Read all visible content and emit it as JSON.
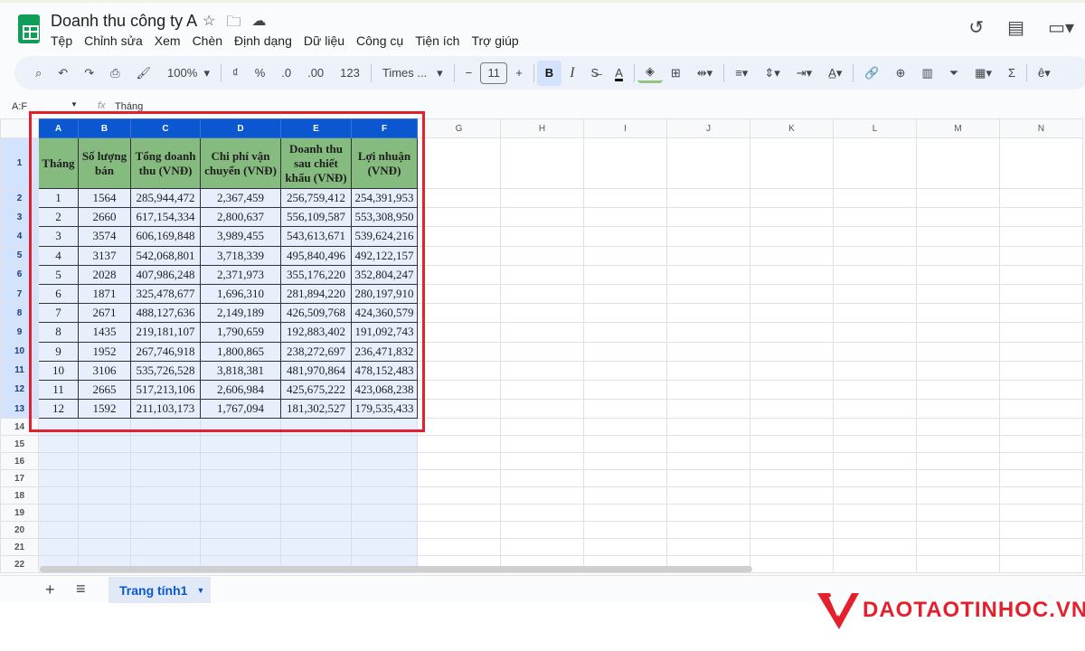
{
  "doc": {
    "title": "Doanh thu công ty A"
  },
  "menu": [
    "Tệp",
    "Chỉnh sửa",
    "Xem",
    "Chèn",
    "Định dạng",
    "Dữ liệu",
    "Công cụ",
    "Tiện ích",
    "Trợ giúp"
  ],
  "toolbar": {
    "zoom": "100%",
    "currency": "₫",
    "percent": "%",
    "dec_less": ".0",
    "dec_more": ".00",
    "number_format": "123",
    "font": "Times ...",
    "font_size": "11",
    "bold": "B",
    "italic": "I",
    "text_color": "A"
  },
  "formula": {
    "name_box": "A:F",
    "fx": "fx",
    "value": "Tháng"
  },
  "columns": [
    "A",
    "B",
    "C",
    "D",
    "E",
    "F",
    "G",
    "H",
    "I",
    "J",
    "K",
    "L",
    "M",
    "N"
  ],
  "headers": [
    "Tháng",
    "Số lượng bán",
    "Tổng doanh thu (VNĐ)",
    "Chi phí vận chuyển (VNĐ)",
    "Doanh thu sau chiết khấu (VNĐ)",
    "Lợi nhuận (VNĐ)"
  ],
  "rows": [
    [
      "1",
      "1564",
      "285,944,472",
      "2,367,459",
      "256,759,412",
      "254,391,953"
    ],
    [
      "2",
      "2660",
      "617,154,334",
      "2,800,637",
      "556,109,587",
      "553,308,950"
    ],
    [
      "3",
      "3574",
      "606,169,848",
      "3,989,455",
      "543,613,671",
      "539,624,216"
    ],
    [
      "4",
      "3137",
      "542,068,801",
      "3,718,339",
      "495,840,496",
      "492,122,157"
    ],
    [
      "5",
      "2028",
      "407,986,248",
      "2,371,973",
      "355,176,220",
      "352,804,247"
    ],
    [
      "6",
      "1871",
      "325,478,677",
      "1,696,310",
      "281,894,220",
      "280,197,910"
    ],
    [
      "7",
      "2671",
      "488,127,636",
      "2,149,189",
      "426,509,768",
      "424,360,579"
    ],
    [
      "8",
      "1435",
      "219,181,107",
      "1,790,659",
      "192,883,402",
      "191,092,743"
    ],
    [
      "9",
      "1952",
      "267,746,918",
      "1,800,865",
      "238,272,697",
      "236,471,832"
    ],
    [
      "10",
      "3106",
      "535,726,528",
      "3,818,381",
      "481,970,864",
      "478,152,483"
    ],
    [
      "11",
      "2665",
      "517,213,106",
      "2,606,984",
      "425,675,222",
      "423,068,238"
    ],
    [
      "12",
      "1592",
      "211,103,173",
      "1,767,094",
      "181,302,527",
      "179,535,433"
    ]
  ],
  "empty_row_count": 9,
  "sheet": {
    "tab": "Trang tính1",
    "add": "+",
    "list": "≡"
  },
  "watermark": "DAOTAOTINHOC.VN"
}
